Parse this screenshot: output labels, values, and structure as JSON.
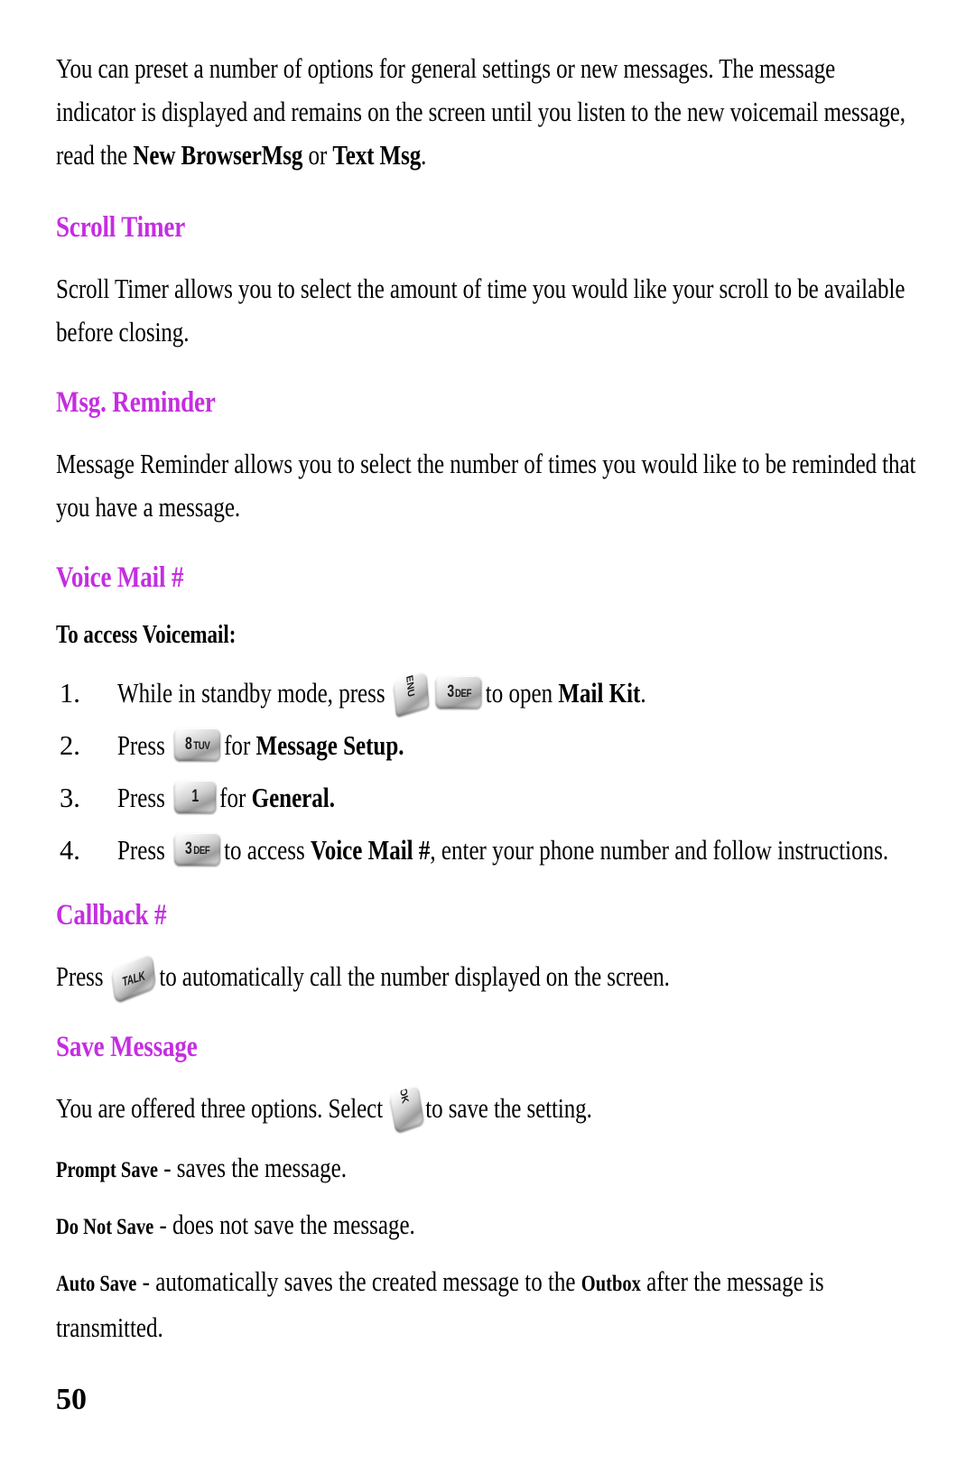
{
  "document": {
    "page_number": "50",
    "heading_color": "#c42ee0",
    "intro": {
      "part1": "You can preset a number of options for general settings or new messages. The message indicator is displayed and remains on the screen until you listen to the new voicemail message, read the ",
      "bold1": "New BrowserMsg",
      "mid": " or ",
      "bold2": "Text Msg",
      "end": "."
    },
    "sections": [
      {
        "id": "scroll-timer",
        "title": "Scroll Timer",
        "body": "Scroll Timer allows you to select the amount of time you would like your scroll to be available before closing."
      },
      {
        "id": "msg-reminder",
        "title": "Msg. Reminder",
        "body": "Message Reminder allows you to select the number of times you would like to be reminded that you have a message."
      },
      {
        "id": "voice-mail",
        "title": "Voice Mail #",
        "lead": "To access Voicemail:"
      },
      {
        "id": "callback",
        "title": "Callback #"
      },
      {
        "id": "save-message",
        "title": "Save Message"
      }
    ],
    "steps": [
      {
        "num": "1.",
        "text_before": "While in standby mode, press",
        "keys": [
          "menu",
          "3def"
        ],
        "text_after": "to open ",
        "bold_after": "Mail Kit",
        "text_end": "."
      },
      {
        "num": "2.",
        "text_before": "Press",
        "keys": [
          "8tuv"
        ],
        "text_after": "for ",
        "bold_after": "Message Setup.",
        "text_end": ""
      },
      {
        "num": "3.",
        "text_before": "Press",
        "keys": [
          "1"
        ],
        "text_after": "for ",
        "bold_after": "General.",
        "text_end": ""
      },
      {
        "num": "4.",
        "text_before": "Press",
        "keys": [
          "3def"
        ],
        "text_after": "to access ",
        "bold_after": "Voice Mail #",
        "text_end": ", enter your phone number and follow instructions."
      }
    ],
    "keys": {
      "menu": {
        "icon_name": "menu-key-icon",
        "label": "MENU",
        "sub": ""
      },
      "3def": {
        "icon_name": "key-3-def-icon",
        "label": "3",
        "sub": "DEF"
      },
      "8tuv": {
        "icon_name": "key-8-tuv-icon",
        "label": "8",
        "sub": "TUV"
      },
      "1": {
        "icon_name": "key-1-icon",
        "label": "1",
        "sub": ""
      },
      "talk": {
        "icon_name": "talk-key-icon",
        "label": "TALK",
        "sub": ""
      },
      "ok": {
        "icon_name": "ok-key-icon",
        "label": "OK",
        "sub": ""
      }
    },
    "callback": {
      "press": "Press",
      "after": "to automatically call the number displayed on the screen."
    },
    "save_message": {
      "intro_before": "You are offered three options. Select",
      "intro_after": "to save the setting.",
      "options": [
        {
          "term": "Prompt Save",
          "desc": " - saves the message."
        },
        {
          "term": "Do Not Save",
          "desc": " - does not save the message."
        }
      ],
      "auto": {
        "term": "Auto Save",
        "desc_before": " - automatically saves the created message to the ",
        "inline_term": "Outbox",
        "desc_after": " after the message is transmitted."
      }
    }
  }
}
